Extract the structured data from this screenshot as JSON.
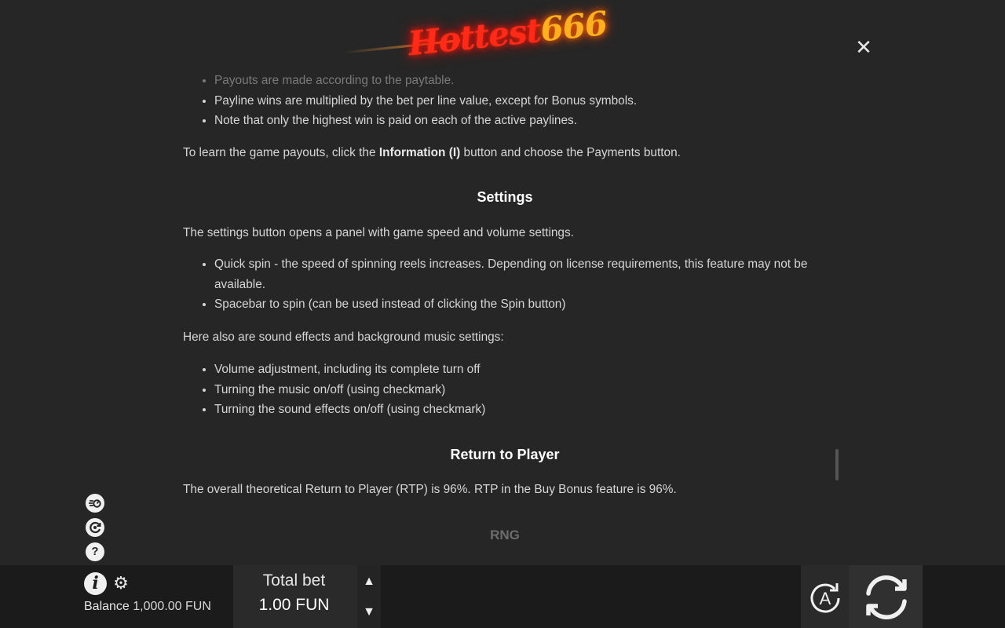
{
  "logo": {
    "word1": "Hottest",
    "word2": "666"
  },
  "content": {
    "top_bullets": [
      "Payouts are made according to the paytable.",
      "Payline wins are multiplied by the bet per line value, except for Bonus symbols.",
      "Note that only the highest win is paid on each of the active paylines."
    ],
    "payouts_prefix": "To learn the game payouts, click the ",
    "payouts_bold": "Information (I)",
    "payouts_suffix": " button and choose the Payments button.",
    "settings_title": "Settings",
    "settings_intro": "The settings button opens a panel with game speed and volume settings.",
    "settings_bullets": [
      "Quick spin - the speed of spinning reels increases. Depending on license requirements, this feature may not be available.",
      "Spacebar to spin (can be used instead of clicking the Spin button)"
    ],
    "sound_intro": "Here also are sound effects and background music settings:",
    "sound_bullets": [
      "Volume adjustment, including its complete turn off",
      "Turning the music on/off (using checkmark)",
      "Turning the sound effects on/off (using checkmark)"
    ],
    "rtp_title": "Return to Player",
    "rtp_text": "The overall theoretical Return to Player (RTP) is 96%. RTP in the Buy Bonus feature is 96%.",
    "rng_title": "RNG"
  },
  "bottom": {
    "balance_label": "Balance",
    "balance_value": "1,000.00 FUN",
    "total_bet_label": "Total bet",
    "total_bet_value": "1.00 FUN",
    "auto_label": "A"
  },
  "icons": {
    "close": "close-icon",
    "quick_spin": "quick-spin-icon",
    "history": "history-icon",
    "help": "help-icon",
    "info": "info-icon",
    "settings": "gear-icon",
    "bet_up": "arrow-up-icon",
    "bet_down": "arrow-down-icon",
    "autoplay": "autoplay-icon",
    "spin": "spin-icon"
  }
}
